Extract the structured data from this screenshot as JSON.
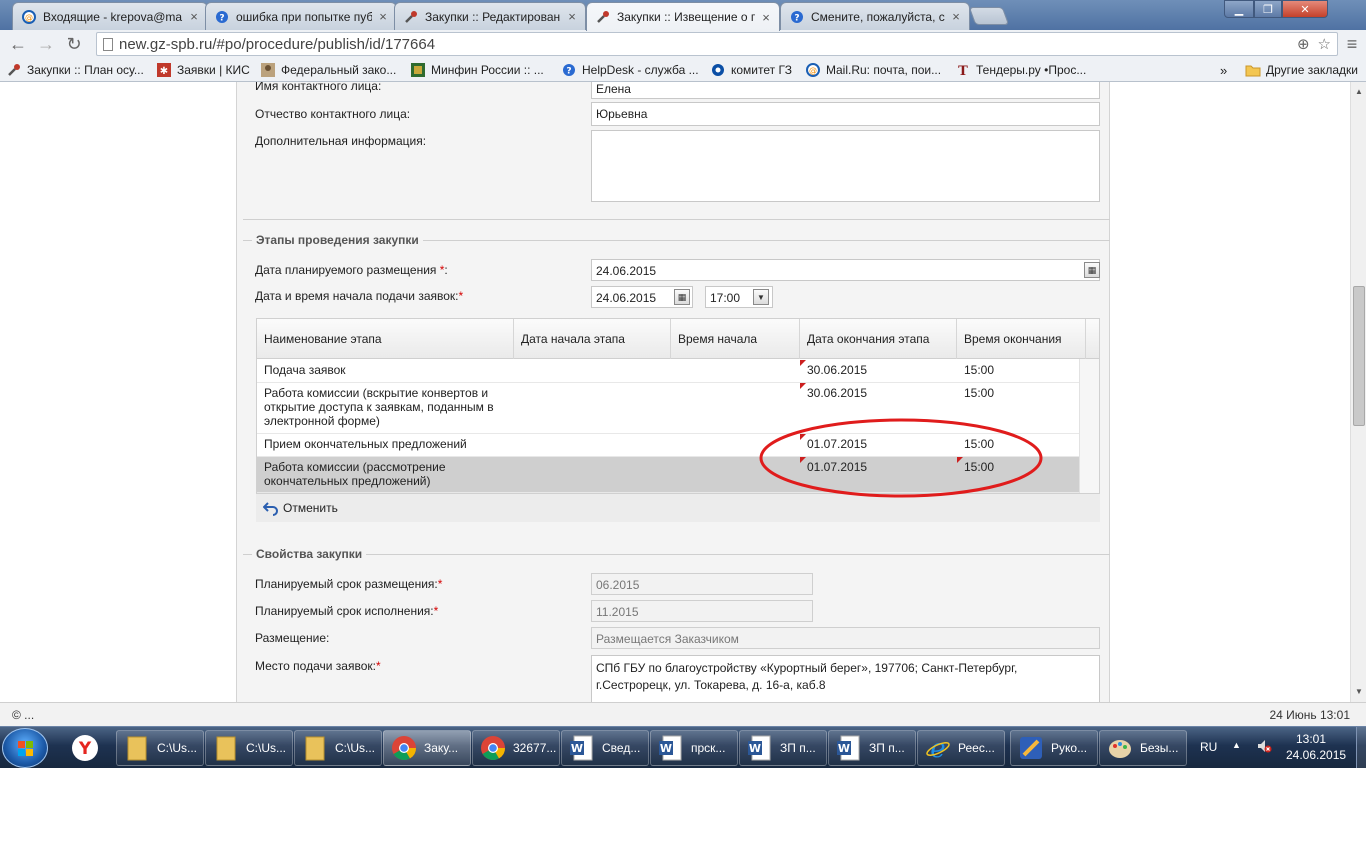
{
  "browser": {
    "tabs": [
      {
        "label": "Входящие - krepova@ma",
        "icon": "mailru-icon"
      },
      {
        "label": "ошибка при попытке пуб",
        "icon": "helpdesk-icon"
      },
      {
        "label": "Закупки :: Редактирован",
        "icon": "tools-icon"
      },
      {
        "label": "Закупки :: Извещение о п",
        "icon": "tools-icon"
      },
      {
        "label": "Смените, пожалуйста, ст",
        "icon": "helpdesk-icon"
      }
    ],
    "tab_close": "×",
    "url": "new.gz-spb.ru/#po/procedure/publish/id/177664",
    "bookmarks": [
      {
        "label": "Закупки :: План осу..."
      },
      {
        "label": "Заявки | КИС"
      },
      {
        "label": "Федеральный зако..."
      },
      {
        "label": "Минфин России :: ..."
      },
      {
        "label": "HelpDesk - служба ..."
      },
      {
        "label": "комитет ГЗ"
      },
      {
        "label": "Mail.Ru: почта, пои..."
      },
      {
        "label": "Тендеры.ру •Прос..."
      }
    ],
    "bookmarks_more": "»",
    "other_bookmarks": "Другие закладки"
  },
  "contact": {
    "first_name_label": "Имя контактного лица:",
    "first_name_value": "Елена",
    "patronymic_label": "Отчество контактного лица:",
    "patronymic_value": "Юрьевна",
    "additional_label": "Дополнительная информация:",
    "additional_value": ""
  },
  "stages": {
    "section_title": "Этапы проведения закупки",
    "planned_date_label": "Дата планируемого размещения ",
    "planned_date_value": "24.06.2015",
    "start_label": "Дата и время начала подачи заявок:",
    "start_date_value": "24.06.2015",
    "start_time_value": "17:00",
    "required_mark": "*",
    "colon": ":",
    "columns": [
      "Наименование этапа",
      "Дата начала этапа",
      "Время начала",
      "Дата окончания этапа",
      "Время окончания"
    ],
    "rows": [
      {
        "name": "Подача заявок",
        "start_date": "",
        "start_time": "",
        "end_date": "30.06.2015",
        "end_time": "15:00"
      },
      {
        "name": "Работа комиссии (вскрытие конвертов и открытие доступа к заявкам, поданным в электронной форме)",
        "start_date": "",
        "start_time": "",
        "end_date": "30.06.2015",
        "end_time": "15:00"
      },
      {
        "name": "Прием окончательных предложений",
        "start_date": "",
        "start_time": "",
        "end_date": "01.07.2015",
        "end_time": "15:00"
      },
      {
        "name": "Работа комиссии (рассмотрение окончательных предложений)",
        "start_date": "",
        "start_time": "",
        "end_date": "01.07.2015",
        "end_time": "15:00"
      }
    ],
    "cancel_label": "Отменить"
  },
  "properties": {
    "section_title": "Свойства закупки",
    "placement_term_label": "Планируемый срок размещения:",
    "placement_term_value": "06.2015",
    "execution_term_label": "Планируемый срок исполнения:",
    "execution_term_value": "11.2015",
    "placement_label": "Размещение:",
    "placement_value": "Размещается Заказчиком",
    "submission_place_label": "Место подачи заявок:",
    "submission_place_value": "СПб ГБУ по благоустройству «Курортный берег», 197706; Санкт-Петербург, г.Сестрорецк, ул. Токарева, д. 16-а, каб.8"
  },
  "status": {
    "left": "© ...",
    "right": "24 Июнь 13:01"
  },
  "taskbar": {
    "items": [
      {
        "label": "C:\\Us..."
      },
      {
        "label": "C:\\Us..."
      },
      {
        "label": "C:\\Us..."
      },
      {
        "label": "Заку..."
      },
      {
        "label": "32677..."
      },
      {
        "label": "Свед..."
      },
      {
        "label": "прск..."
      },
      {
        "label": "ЗП п..."
      },
      {
        "label": "ЗП п..."
      },
      {
        "label": "Реес..."
      },
      {
        "label": "Руко..."
      },
      {
        "label": "Безы..."
      }
    ],
    "lang": "RU",
    "time": "13:01",
    "date": "24.06.2015"
  },
  "colors": {
    "annotation_ellipse": "#e01c1c",
    "required": "#d40000"
  }
}
